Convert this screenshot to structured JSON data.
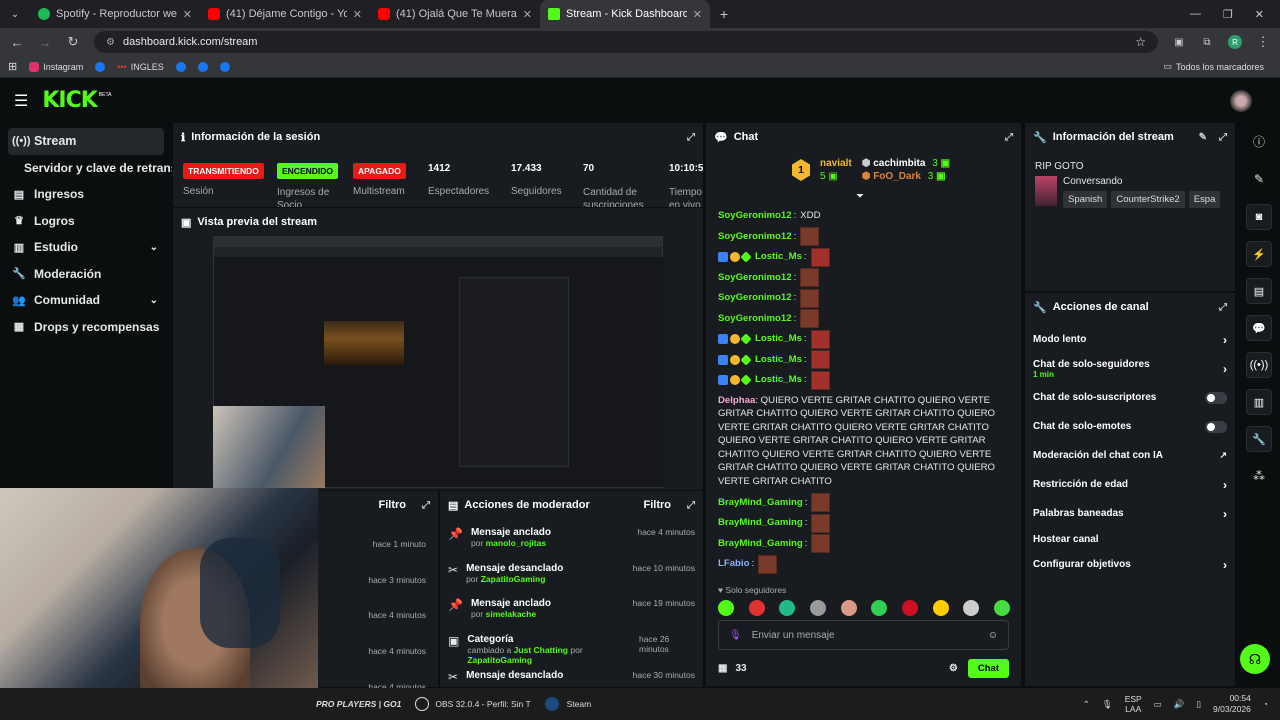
{
  "browser": {
    "tabs": [
      {
        "title": "Spotify - Reproductor web: mú",
        "color": "#1db954"
      },
      {
        "title": "(41) Déjame Contigo - YouTube",
        "color": "#ff0000"
      },
      {
        "title": "(41) Ojalá Que Te Mueras - You",
        "color": "#ff0000"
      },
      {
        "title": "Stream - Kick Dashboard",
        "color": "#53fc18"
      }
    ],
    "url": "dashboard.kick.com/stream",
    "bookmarks": [
      "Instagram",
      "INGLES"
    ],
    "all_bookmarks": "Todos los marcadores",
    "profile_initial": "R"
  },
  "app": {
    "logo": "KICK",
    "logo_beta": "BETA"
  },
  "sidebar": {
    "items": [
      {
        "label": "Stream",
        "icon": "stream-icon"
      },
      {
        "label": "Servidor y clave de retransmisión"
      },
      {
        "label": "Ingresos",
        "icon": "revenue-icon"
      },
      {
        "label": "Logros",
        "icon": "trophy-icon"
      },
      {
        "label": "Estudio",
        "icon": "studio-icon"
      },
      {
        "label": "Moderación",
        "icon": "wrench-icon"
      },
      {
        "label": "Comunidad",
        "icon": "community-icon"
      },
      {
        "label": "Drops y recompensas",
        "icon": "gift-icon"
      }
    ]
  },
  "session": {
    "title": "Información de la sesión",
    "badges": [
      {
        "text": "TRANSMITIENDO",
        "label": "Sesión",
        "color": "#e91916"
      },
      {
        "text": "ENCENDIDO",
        "label": "Ingresos de Socio",
        "color": "#53fc18"
      },
      {
        "text": "APAGADO",
        "label": "Multistream",
        "color": "#e91916"
      }
    ],
    "stats": [
      {
        "value": "1412",
        "label": "Espectadores"
      },
      {
        "value": "17.433",
        "label": "Seguidores"
      },
      {
        "value": "70",
        "label": "Cantidad de suscripciones"
      },
      {
        "value": "10:10:5",
        "label": "Tiempo en vivo"
      }
    ]
  },
  "preview": {
    "title": "Vista previa del stream"
  },
  "left_panel": {
    "filter": "Filtro",
    "times": [
      "hace 1 minuto",
      "hace 3 minutos",
      "hace 4 minutos",
      "hace 4 minutos",
      "hace 4 minutos"
    ]
  },
  "mod_actions": {
    "title": "Acciones de moderador",
    "filter": "Filtro",
    "items": [
      {
        "action": "Mensaje anclado",
        "by_prefix": "por",
        "user": "manolo_rojitas",
        "time": "hace 4 minutos"
      },
      {
        "action": "Mensaje desanclado",
        "by_prefix": "por",
        "user": "ZapatitoGaming",
        "time": "hace 10 minutos"
      },
      {
        "action": "Mensaje anclado",
        "by_prefix": "por",
        "user": "simelakache",
        "time": "hace 19 minutos"
      },
      {
        "action": "Categoría",
        "detail": "cambiado a",
        "target": "Just Chatting",
        "by_prefix": "por",
        "user": "ZapatitoGaming",
        "time": "hace 26 minutos"
      },
      {
        "action": "Mensaje desanclado",
        "time": "hace 30 minutos"
      }
    ]
  },
  "chat": {
    "title": "Chat",
    "top_gifters": [
      {
        "name": "navialt",
        "count": "5"
      },
      {
        "name": "cachimbita",
        "count": "3"
      },
      {
        "name": "FoO_Dark",
        "count": "3"
      }
    ],
    "messages": [
      {
        "user": "SoyGeronimo12",
        "text": "XDD"
      },
      {
        "user": "SoyGeronimo12",
        "text": ""
      },
      {
        "user": "Lostic_Ms",
        "text": ""
      },
      {
        "user": "SoyGeronimo12",
        "text": ""
      },
      {
        "user": "SoyGeronimo12",
        "text": ""
      },
      {
        "user": "SoyGeronimo12",
        "text": ""
      },
      {
        "user": "Lostic_Ms",
        "text": ""
      },
      {
        "user": "Lostic_Ms",
        "text": ""
      },
      {
        "user": "Lostic_Ms",
        "text": ""
      }
    ],
    "long_message": {
      "user": "Delphaa",
      "text": "QUIERO VERTE GRITAR CHATITO QUIERO VERTE GRITAR CHATITO QUIERO VERTE GRITAR CHATITO QUIERO VERTE GRITAR CHATITO QUIERO VERTE GRITAR CHATITO QUIERO VERTE GRITAR CHATITO QUIERO VERTE GRITAR CHATITO QUIERO VERTE GRITAR CHATITO QUIERO VERTE GRITAR CHATITO QUIERO VERTE GRITAR CHATITO QUIERO VERTE GRITAR CHATITO"
    },
    "messages2": [
      {
        "user": "BrayMind_Gaming"
      },
      {
        "user": "BrayMind_Gaming"
      },
      {
        "user": "BrayMind_Gaming"
      },
      {
        "user": "LFabio"
      }
    ],
    "mode": "Solo seguidores",
    "placeholder": "Enviar un mensaje",
    "viewers": "33",
    "send": "Chat"
  },
  "stream_info": {
    "title": "Información del stream",
    "stream_title": "RIP GOTO",
    "category": "Conversando",
    "tags": [
      "Spanish",
      "CounterStrike2",
      "Espa"
    ]
  },
  "channel_actions": {
    "title": "Acciones de canal",
    "items": [
      {
        "label": "Modo lento",
        "control": "arrow"
      },
      {
        "label": "Chat de solo-seguidores",
        "sub": "1 min",
        "control": "arrow"
      },
      {
        "label": "Chat de solo-suscriptores",
        "control": "toggle"
      },
      {
        "label": "Chat de solo-emotes",
        "control": "toggle"
      },
      {
        "label": "Moderación del chat con IA",
        "control": "external"
      },
      {
        "label": "Restricción de edad",
        "control": "arrow"
      },
      {
        "label": "Palabras baneadas",
        "control": "arrow"
      },
      {
        "label": "Hostear canal",
        "control": "none"
      },
      {
        "label": "Configurar objetivos",
        "control": "arrow"
      }
    ]
  },
  "taskbar": {
    "items": [
      "PRO PLAYERS | GO1",
      "OBS 32.0.4 - Perfil: Sin T",
      "Steam"
    ],
    "lang": "ESP",
    "lang2": "LAA",
    "time": "00:54",
    "date": "9/03/2026"
  }
}
